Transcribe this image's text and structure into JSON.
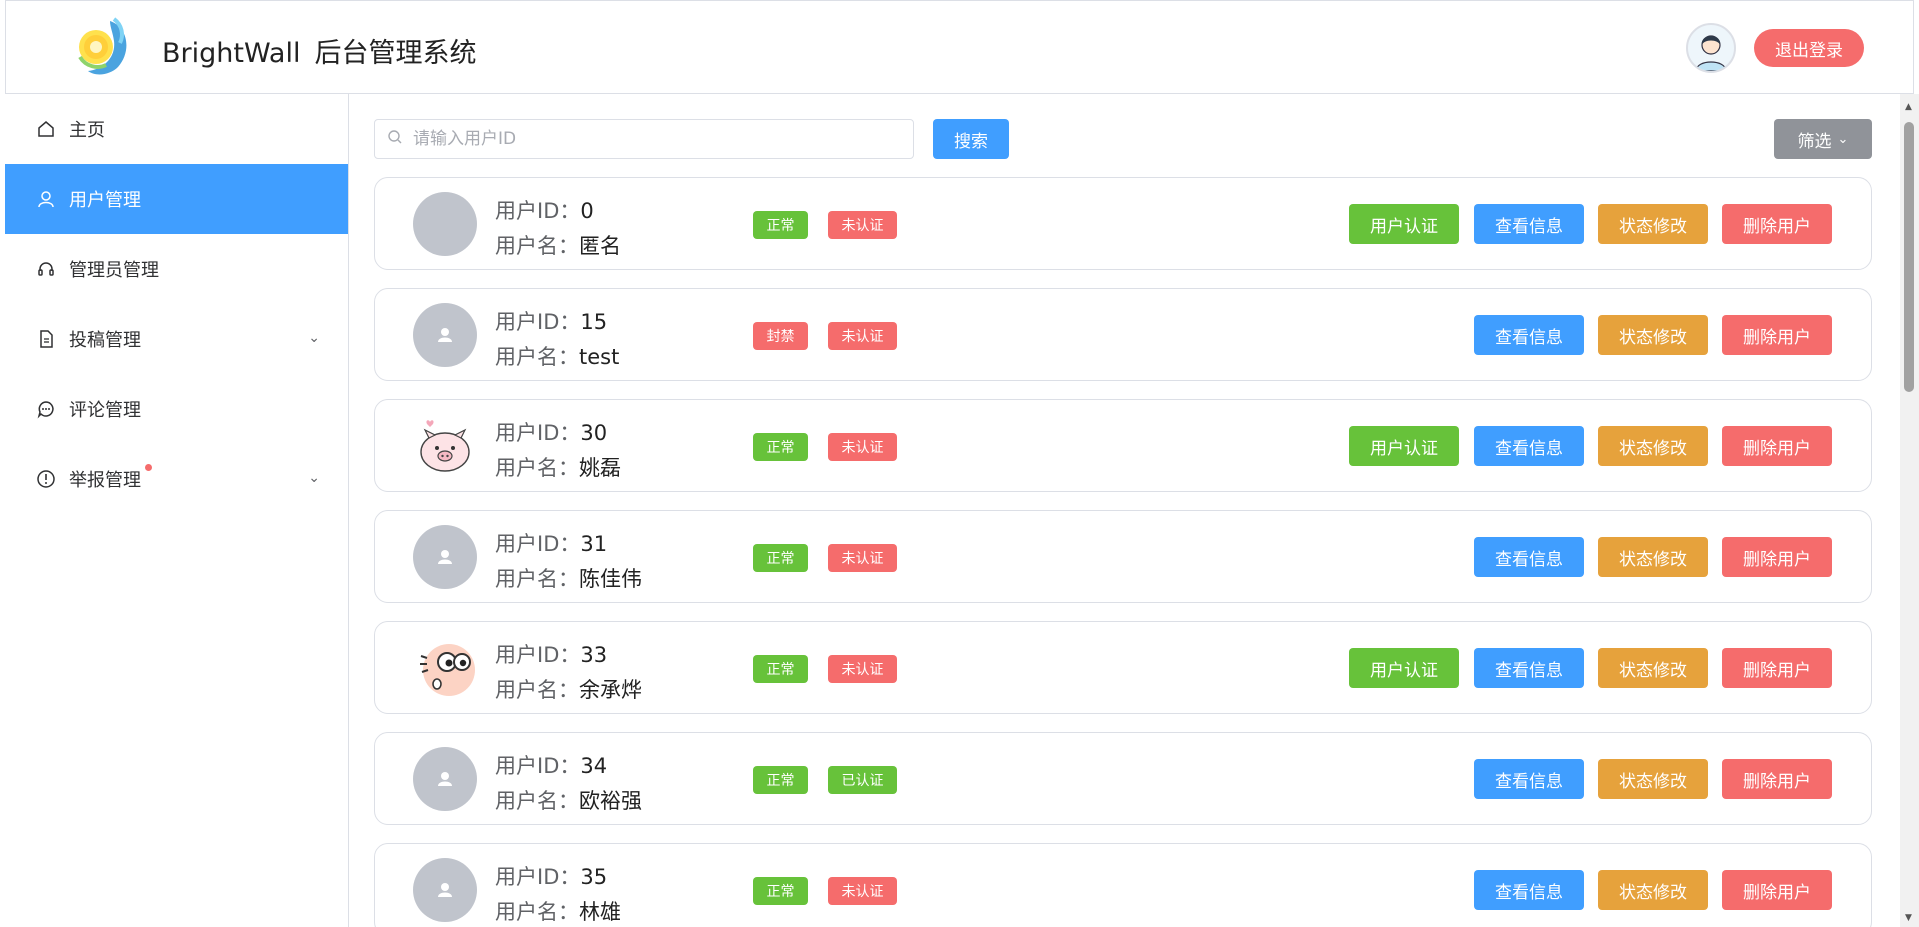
{
  "header": {
    "brand": "BrightWall",
    "system_title": "后台管理系统",
    "logout_label": "退出登录"
  },
  "sidebar": {
    "items": [
      {
        "label": "主页",
        "icon": "home-icon"
      },
      {
        "label": "用户管理",
        "icon": "user-icon",
        "active": true
      },
      {
        "label": "管理员管理",
        "icon": "headset-icon"
      },
      {
        "label": "投稿管理",
        "icon": "document-icon",
        "has_arrow": true
      },
      {
        "label": "评论管理",
        "icon": "chat-icon"
      },
      {
        "label": "举报管理",
        "icon": "warning-icon",
        "has_arrow": true,
        "badge_dot": true
      }
    ]
  },
  "toolbar": {
    "search_placeholder": "请输入用户ID",
    "search_label": "搜索",
    "filter_label": "筛选"
  },
  "labels": {
    "user_id": "用户ID：",
    "user_name": "用户名：",
    "auth_btn": "用户认证",
    "view_btn": "查看信息",
    "status_btn": "状态修改",
    "delete_btn": "删除用户"
  },
  "colors": {
    "primary": "#409eff",
    "success": "#67c23a",
    "warning": "#e6a23c",
    "danger": "#f56c6c",
    "info": "#909399"
  },
  "users": [
    {
      "id": "0",
      "name": "匿名",
      "status": "正常",
      "auth": "未认证",
      "avatar": "blank",
      "show_auth_btn": true
    },
    {
      "id": "15",
      "name": "test",
      "status": "封禁",
      "auth": "未认证",
      "avatar": "default",
      "show_auth_btn": false
    },
    {
      "id": "30",
      "name": "姚磊",
      "status": "正常",
      "auth": "未认证",
      "avatar": "pig",
      "show_auth_btn": true
    },
    {
      "id": "31",
      "name": "陈佳伟",
      "status": "正常",
      "auth": "未认证",
      "avatar": "default",
      "show_auth_btn": false
    },
    {
      "id": "33",
      "name": "余承烨",
      "status": "正常",
      "auth": "未认证",
      "avatar": "cartoon",
      "show_auth_btn": true
    },
    {
      "id": "34",
      "name": "欧裕强",
      "status": "正常",
      "auth": "已认证",
      "avatar": "default",
      "show_auth_btn": false
    },
    {
      "id": "35",
      "name": "林雄",
      "status": "正常",
      "auth": "未认证",
      "avatar": "default",
      "show_auth_btn": false
    }
  ]
}
